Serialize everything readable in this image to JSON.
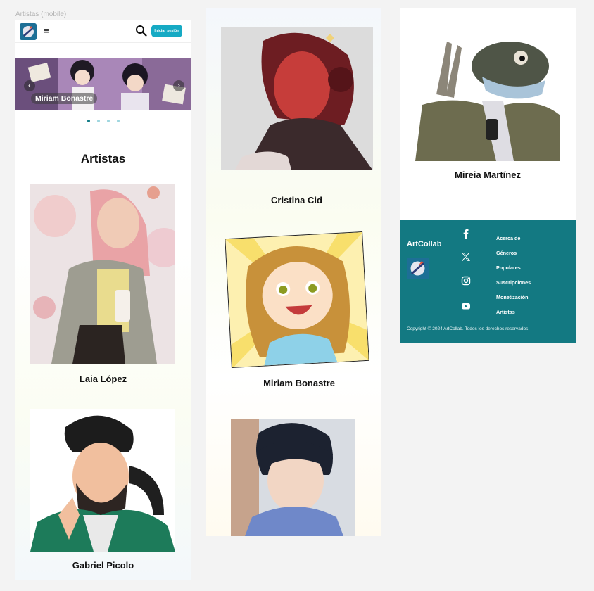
{
  "frame_label": "Artistas (mobile)",
  "nav": {
    "login_label": "Iniciar sesión",
    "menu_icon": "≡"
  },
  "carousel": {
    "caption": "Miriam Bonastre",
    "prev": "‹",
    "next": "›",
    "slide_count": 4,
    "active_index": 0
  },
  "section_title": "Artistas",
  "artists": [
    {
      "name": "Laia López"
    },
    {
      "name": "Gabriel Picolo"
    },
    {
      "name": "Cristina Cid"
    },
    {
      "name": "Miriam Bonastre"
    },
    {
      "name": "Mireia Martínez"
    }
  ],
  "footer": {
    "brand": "ArtCollab",
    "social_icons": [
      "facebook-icon",
      "x-icon",
      "instagram-icon",
      "youtube-icon"
    ],
    "links": [
      "Acerca de",
      "Géneros",
      "Populares",
      "Suscripciones",
      "Monetización",
      "Artistas"
    ],
    "copyright": "Copyright © 2024 ArtCollab.   Todos los derechos reservados"
  },
  "colors": {
    "accent": "#16aac4",
    "footer_bg": "#137982",
    "dot_active": "#137d88",
    "dot_inactive": "#9fd7e0"
  }
}
